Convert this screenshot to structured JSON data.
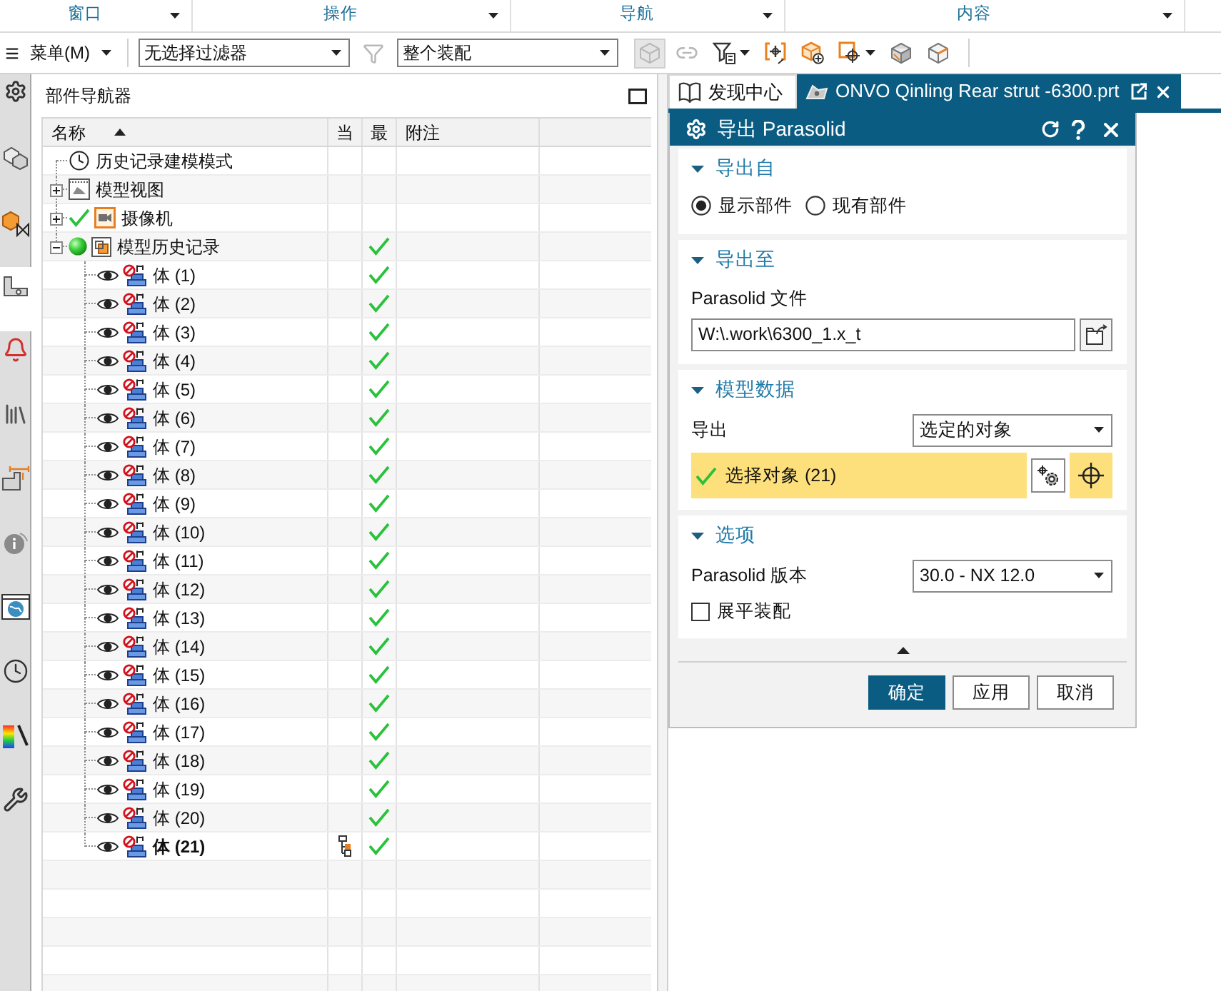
{
  "ribbon_groups": [
    {
      "label": "窗口"
    },
    {
      "label": "操作"
    },
    {
      "label": "导航"
    },
    {
      "label": "内容"
    }
  ],
  "toolbar": {
    "menu_label": "菜单(M)",
    "selection_filter": "无选择过滤器",
    "filter_reset": {
      "disabled": true
    },
    "scope": "整个装配",
    "tools": [
      {
        "kind": "solid",
        "disabled": true,
        "toggled": true,
        "menu": false
      },
      {
        "kind": "chain",
        "disabled": true,
        "toggled": false,
        "menu": false
      },
      {
        "kind": "type_filter",
        "disabled": false,
        "toggled": false,
        "menu": true
      },
      {
        "kind": "bracket",
        "disabled": false,
        "toggled": false,
        "menu": false
      },
      {
        "kind": "cube_add",
        "disabled": false,
        "toggled": false,
        "menu": false
      },
      {
        "kind": "snap",
        "disabled": false,
        "toggled": false,
        "menu": true
      },
      {
        "kind": "shaded_cube",
        "disabled": false,
        "toggled": false,
        "menu": false
      },
      {
        "kind": "wire_cube",
        "disabled": false,
        "toggled": false,
        "menu": false
      }
    ]
  },
  "resource_bar": [
    {
      "kind": "settings",
      "selected": false
    },
    {
      "kind": "assemblies",
      "selected": false
    },
    {
      "kind": "sheet",
      "selected": false
    },
    {
      "kind": "part",
      "selected": true
    },
    {
      "kind": "alerts",
      "selected": false
    },
    {
      "kind": "library",
      "selected": false
    },
    {
      "kind": "dimensions",
      "selected": false
    },
    {
      "kind": "info",
      "selected": false
    },
    {
      "kind": "browser",
      "selected": false
    },
    {
      "kind": "history",
      "selected": false
    },
    {
      "kind": "palette",
      "selected": false
    },
    {
      "kind": "tools",
      "selected": false
    }
  ],
  "part_navigator": {
    "title": "部件导航器",
    "columns": [
      {
        "label": "名称",
        "sorted": true
      },
      {
        "label": "当",
        "sorted": false
      },
      {
        "label": "最",
        "sorted": false
      },
      {
        "label": "附注",
        "sorted": false
      }
    ],
    "tree": [
      {
        "kind": "mode",
        "label": "历史记录建模模式",
        "checked": false,
        "latest": false
      },
      {
        "kind": "views",
        "label": "模型视图",
        "expanded": false,
        "checked": false,
        "latest": false
      },
      {
        "kind": "camera",
        "label": "摄像机",
        "expanded": false,
        "checked": true,
        "latest": false
      },
      {
        "kind": "history",
        "label": "模型历史记录",
        "expanded": true,
        "checked": false,
        "latest": true,
        "children": [
          {
            "label": "体 (1)",
            "visible": true,
            "current": false,
            "latest": true
          },
          {
            "label": "体 (2)",
            "visible": true,
            "current": false,
            "latest": true
          },
          {
            "label": "体 (3)",
            "visible": true,
            "current": false,
            "latest": true
          },
          {
            "label": "体 (4)",
            "visible": true,
            "current": false,
            "latest": true
          },
          {
            "label": "体 (5)",
            "visible": true,
            "current": false,
            "latest": true
          },
          {
            "label": "体 (6)",
            "visible": true,
            "current": false,
            "latest": true
          },
          {
            "label": "体 (7)",
            "visible": true,
            "current": false,
            "latest": true
          },
          {
            "label": "体 (8)",
            "visible": true,
            "current": false,
            "latest": true
          },
          {
            "label": "体 (9)",
            "visible": true,
            "current": false,
            "latest": true
          },
          {
            "label": "体 (10)",
            "visible": true,
            "current": false,
            "latest": true
          },
          {
            "label": "体 (11)",
            "visible": true,
            "current": false,
            "latest": true
          },
          {
            "label": "体 (12)",
            "visible": true,
            "current": false,
            "latest": true
          },
          {
            "label": "体 (13)",
            "visible": true,
            "current": false,
            "latest": true
          },
          {
            "label": "体 (14)",
            "visible": true,
            "current": false,
            "latest": true
          },
          {
            "label": "体 (15)",
            "visible": true,
            "current": false,
            "latest": true
          },
          {
            "label": "体 (16)",
            "visible": true,
            "current": false,
            "latest": true
          },
          {
            "label": "体 (17)",
            "visible": true,
            "current": false,
            "latest": true
          },
          {
            "label": "体 (18)",
            "visible": true,
            "current": false,
            "latest": true
          },
          {
            "label": "体 (19)",
            "visible": true,
            "current": false,
            "latest": true
          },
          {
            "label": "体 (20)",
            "visible": true,
            "current": false,
            "latest": true
          },
          {
            "label": "体 (21)",
            "visible": true,
            "current": true,
            "latest": true
          }
        ]
      }
    ]
  },
  "tabs": [
    {
      "kind": "resource",
      "label": "发现中心",
      "selected": false
    },
    {
      "kind": "part",
      "label": "ONVO Qinling Rear strut -6300.prt",
      "selected": true
    }
  ],
  "dialog": {
    "title": "导出 Parasolid",
    "sections": [
      {
        "title": "导出自",
        "expanded": true,
        "rows": [
          {
            "kind": "radio_group",
            "options": [
              {
                "label": "显示部件",
                "selected": true
              },
              {
                "label": "现有部件",
                "selected": false
              }
            ]
          }
        ]
      },
      {
        "title": "导出至",
        "expanded": true,
        "rows": [
          {
            "kind": "caption",
            "label": "Parasolid 文件"
          },
          {
            "kind": "file_input",
            "value": "W:\\.work\\6300_1.x_t"
          }
        ]
      },
      {
        "title": "模型数据",
        "expanded": true,
        "rows": [
          {
            "kind": "dropdown",
            "label": "导出",
            "value": "选定的对象"
          },
          {
            "kind": "selection",
            "label": "选择对象 (21)",
            "active": true,
            "complete": true
          }
        ]
      },
      {
        "title": "选项",
        "expanded": true,
        "rows": [
          {
            "kind": "dropdown",
            "label": "Parasolid 版本",
            "value": "30.0 - NX 12.0"
          },
          {
            "kind": "checkbox",
            "label": "展平装配",
            "checked": false
          }
        ]
      }
    ],
    "buttons": [
      {
        "label": "确定",
        "primary": true
      },
      {
        "label": "应用",
        "primary": false
      },
      {
        "label": "取消",
        "primary": false
      }
    ]
  }
}
